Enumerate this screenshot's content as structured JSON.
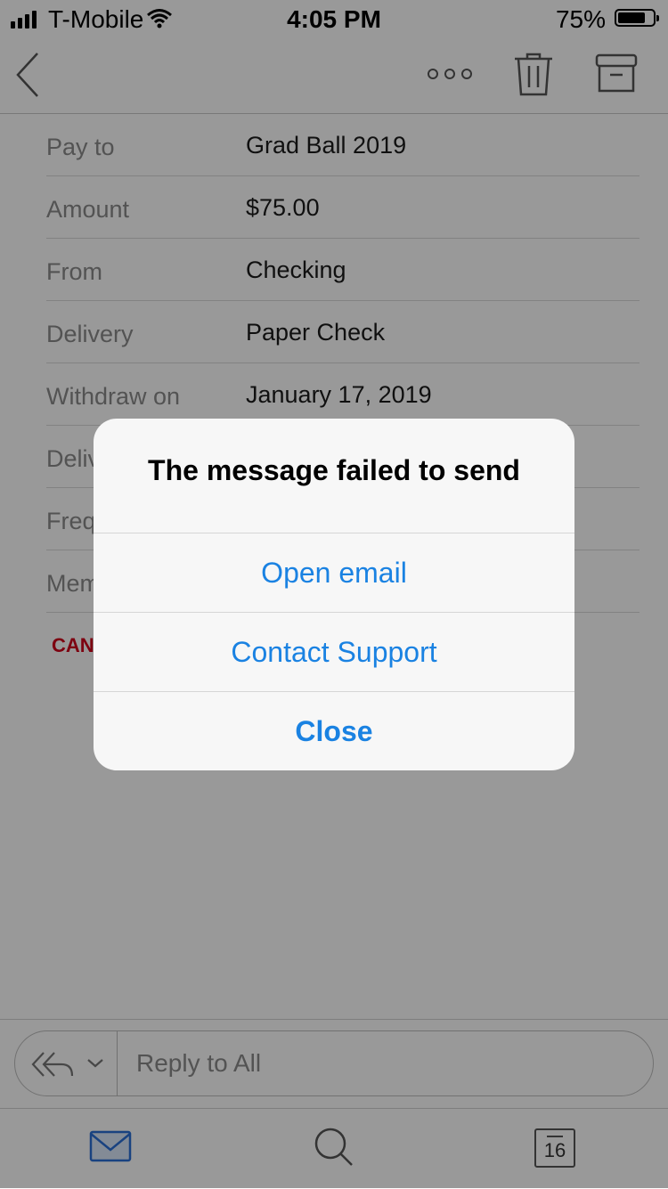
{
  "status_bar": {
    "carrier": "T-Mobile",
    "time": "4:05 PM",
    "battery": "75%"
  },
  "details": {
    "rows": [
      {
        "label": "Pay to",
        "value": "Grad Ball 2019"
      },
      {
        "label": "Amount",
        "value": "$75.00"
      },
      {
        "label": "From",
        "value": "Checking"
      },
      {
        "label": "Delivery",
        "value": "Paper Check"
      },
      {
        "label": "Withdraw on",
        "value": "January 17, 2019"
      },
      {
        "label": "Deliv",
        "value": ""
      },
      {
        "label": "Freq",
        "value": ""
      },
      {
        "label": "Mem",
        "value": ""
      }
    ],
    "cancel_label": "CAN"
  },
  "reply_bar": {
    "placeholder": "Reply to All"
  },
  "tab_bar": {
    "calendar_day": "16"
  },
  "alert": {
    "title": "The message failed to send",
    "open_email": "Open email",
    "contact_support": "Contact Support",
    "close": "Close"
  },
  "colors": {
    "accent": "#1a82e2",
    "cancel": "#d0021b",
    "mail_tab": "#2a6fd6"
  }
}
